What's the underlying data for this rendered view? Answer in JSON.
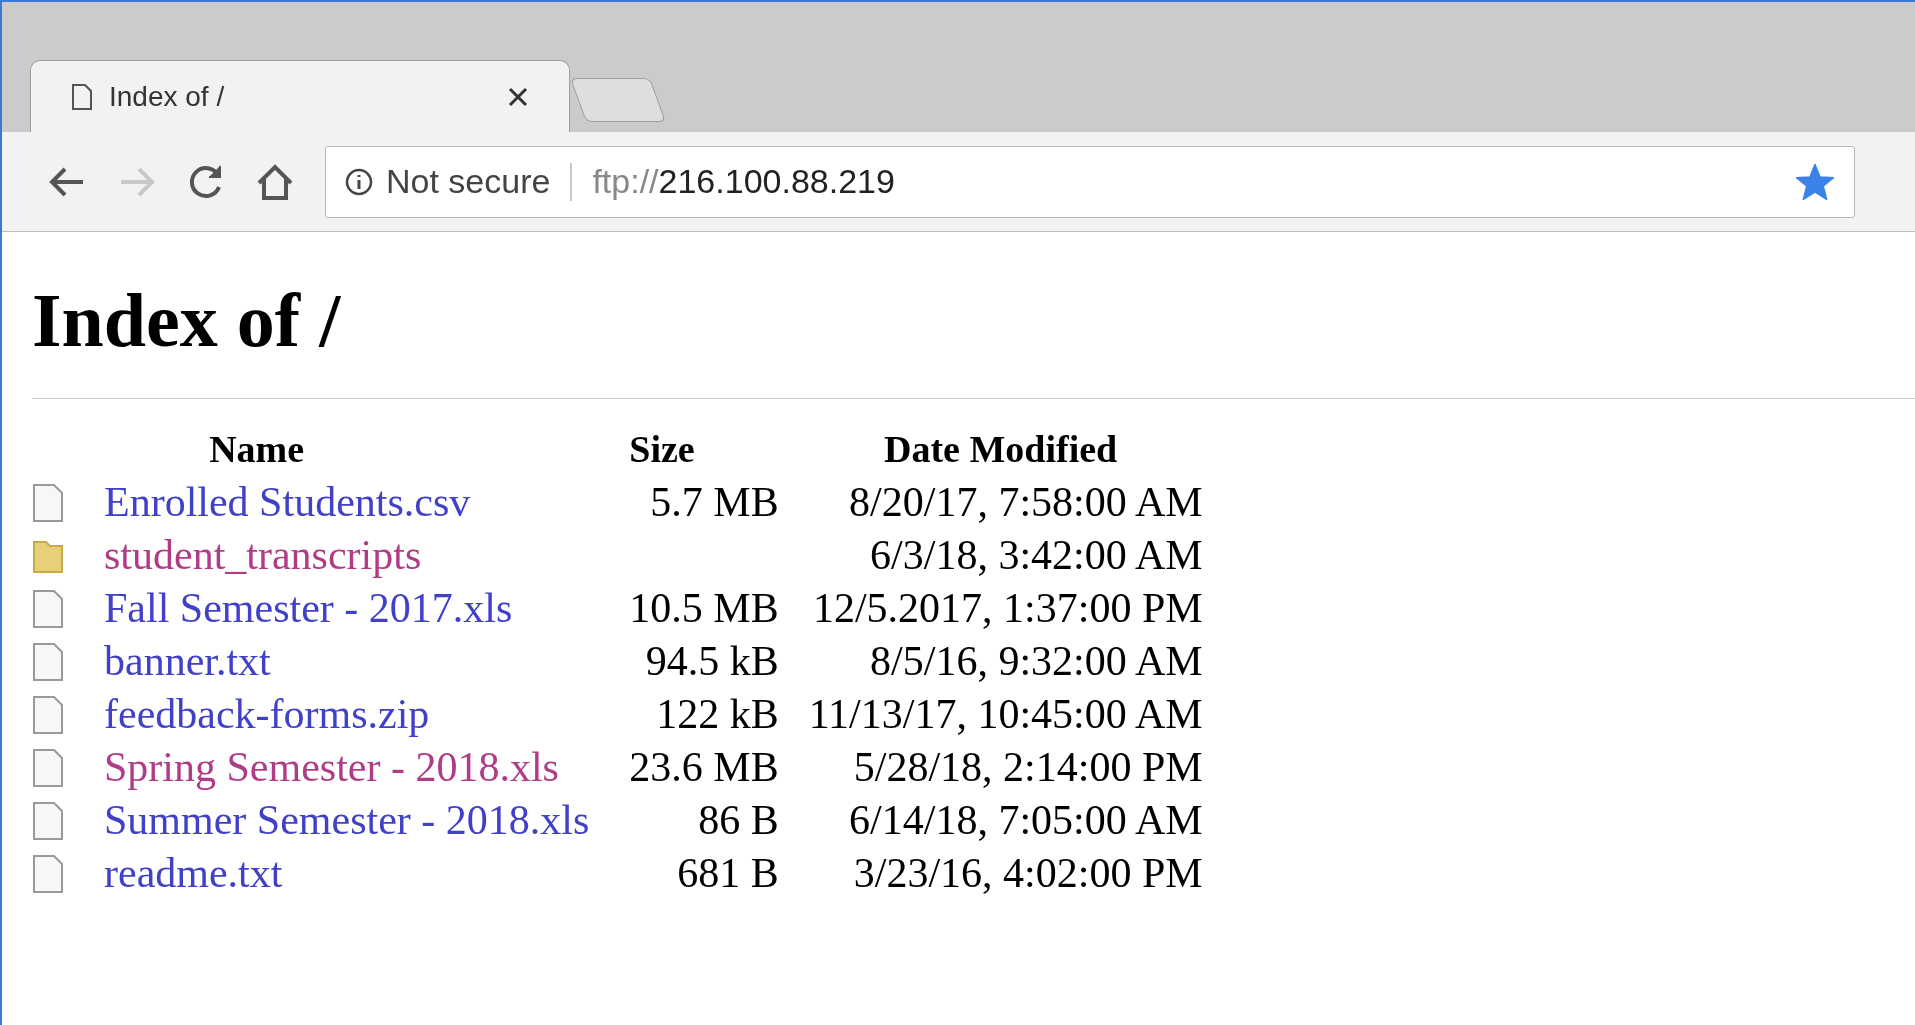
{
  "tab": {
    "title": "Index of /",
    "selected": true
  },
  "address_bar": {
    "security": "Not secure",
    "url_scheme": "ftp://",
    "url_host": "216.100.88.219",
    "bookmarked": true
  },
  "page": {
    "heading": "Index of /",
    "columns": [
      "Name",
      "Size",
      "Date Modified"
    ],
    "rows": [
      {
        "kind": "file",
        "name": "Enrolled Students.csv",
        "visited": false,
        "size": "5.7 MB",
        "date": "8/20/17, 7:58:00 AM"
      },
      {
        "kind": "folder",
        "name": "student_transcripts",
        "visited": true,
        "date": "6/3/18, 3:42:00 AM"
      },
      {
        "kind": "file",
        "name": "Fall Semester - 2017.xls",
        "visited": false,
        "size": "10.5 MB",
        "date": "12/5.2017, 1:37:00 PM"
      },
      {
        "kind": "file",
        "name": "banner.txt",
        "visited": false,
        "size": "94.5 kB",
        "date": "8/5/16, 9:32:00 AM"
      },
      {
        "kind": "file",
        "name": "feedback-forms.zip",
        "visited": false,
        "size": "122 kB",
        "date": "11/13/17, 10:45:00 AM"
      },
      {
        "kind": "file",
        "name": "Spring Semester - 2018.xls",
        "visited": true,
        "size": "23.6 MB",
        "date": "5/28/18, 2:14:00 PM"
      },
      {
        "kind": "file",
        "name": "Summer Semester - 2018.xls",
        "visited": false,
        "size": "86 B",
        "date": "6/14/18, 7:05:00 AM"
      },
      {
        "kind": "file",
        "name": "readme.txt",
        "visited": false,
        "size": "681 B",
        "date": "3/23/16, 4:02:00 PM"
      }
    ]
  }
}
